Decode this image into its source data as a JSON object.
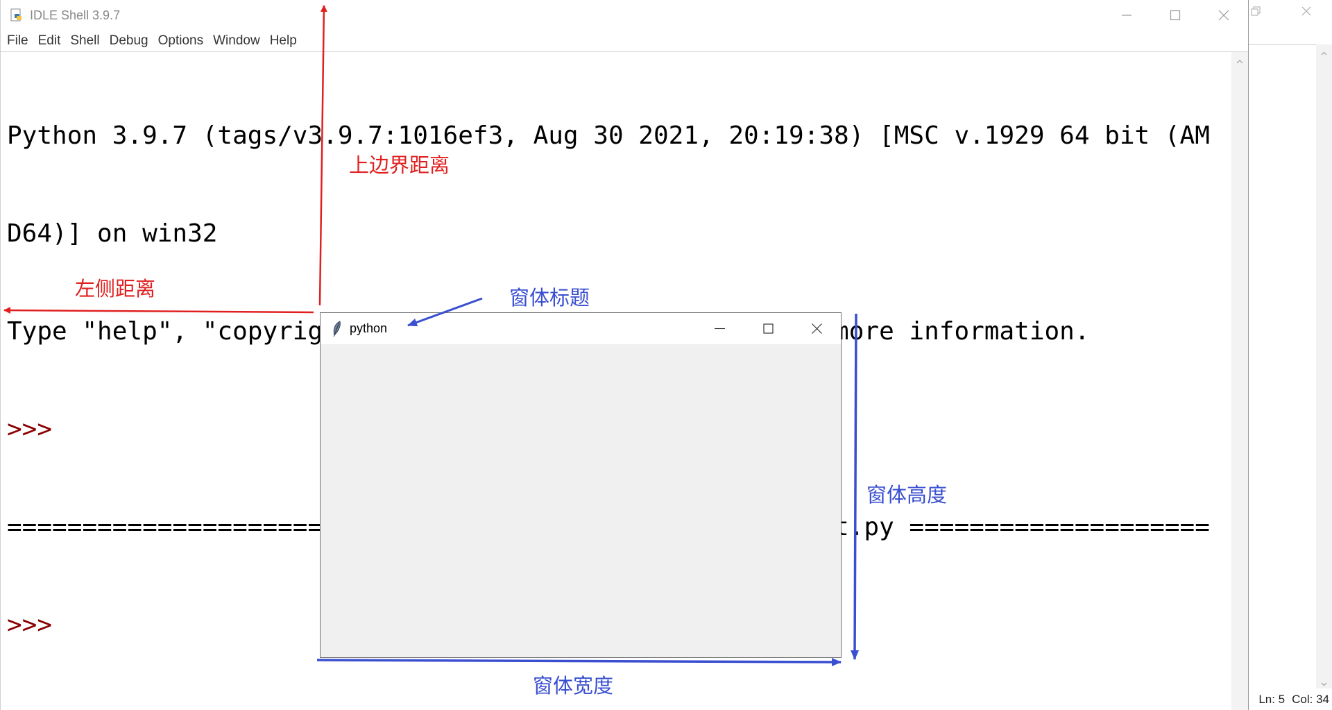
{
  "idle": {
    "title": "IDLE Shell 3.9.7",
    "menu": [
      "File",
      "Edit",
      "Shell",
      "Debug",
      "Options",
      "Window",
      "Help"
    ],
    "lines": [
      {
        "text": "Python 3.9.7 (tags/v3.9.7:1016ef3, Aug 30 2021, 20:19:38) [MSC v.1929 64 bit (AM",
        "kind": "output"
      },
      {
        "text": "D64)] on win32",
        "kind": "output"
      },
      {
        "text": "Type \"help\", \"copyright\", \"credits\" or \"license()\" for more information.",
        "kind": "output"
      },
      {
        "text": ">>>",
        "kind": "prompt"
      },
      {
        "text": "===================== RESTART: C:/Users/SXH/Desktop/test.py ====================",
        "kind": "output"
      },
      {
        "text": ">>>",
        "kind": "prompt"
      }
    ]
  },
  "status": {
    "ln": "Ln: 5",
    "col": "Col: 34"
  },
  "tk_window": {
    "title": "python"
  },
  "annotations": {
    "top_distance": "上边界距离",
    "left_distance": "左侧距离",
    "window_title": "窗体标题",
    "window_height": "窗体高度",
    "window_width": "窗体宽度"
  },
  "colors": {
    "annotation_red": "#e02020",
    "annotation_blue": "#3a4fd0",
    "prompt": "#8b0000",
    "tk_client": "#f0f0f0"
  },
  "icons": {
    "idle_app": "python-idle-icon",
    "tk_app": "tk-feather-icon",
    "minimize": "minimize-icon",
    "maximize": "maximize-icon",
    "close": "close-icon",
    "restore": "restore-icon"
  }
}
